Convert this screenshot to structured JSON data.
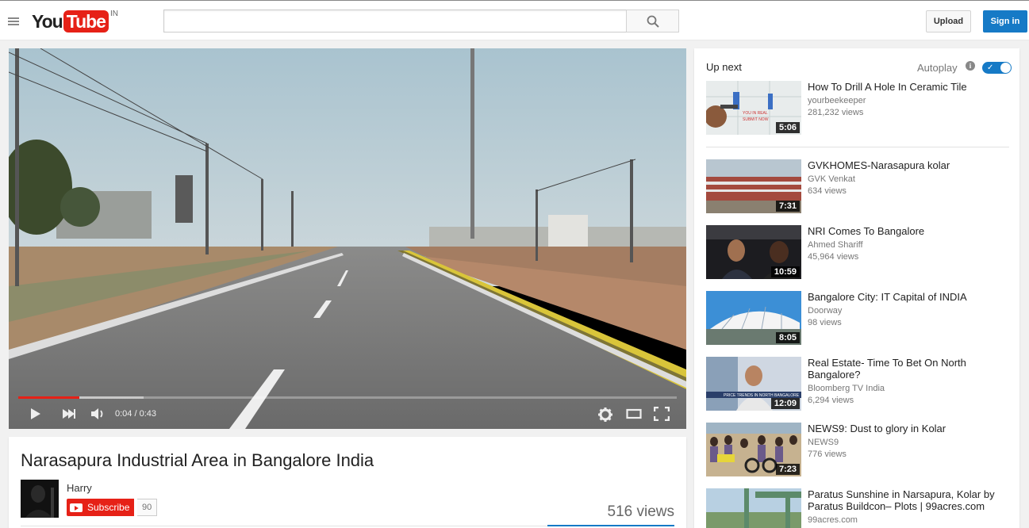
{
  "masthead": {
    "logo_you": "You",
    "logo_tube": "Tube",
    "logo_country": "IN",
    "search_placeholder": "",
    "upload_label": "Upload",
    "signin_label": "Sign in"
  },
  "player": {
    "current_time": "0:04",
    "separator": " / ",
    "duration": "0:43",
    "played_fraction": 0.093,
    "buffered_fraction": 0.19
  },
  "video": {
    "title": "Narasapura Industrial Area in Bangalore India",
    "channel": "Harry",
    "subscribe_label": "Subscribe",
    "subscriber_count": "90",
    "views": "516 views"
  },
  "sidebar": {
    "up_next_label": "Up next",
    "autoplay_label": "Autoplay",
    "autoplay_on": true,
    "items": [
      {
        "title": "How To Drill A Hole In Ceramic Tile",
        "channel": "yourbeekeeper",
        "views": "281,232 views",
        "duration": "5:06",
        "thumb": "tile"
      },
      {
        "title": "GVKHOMES-Narasapura kolar",
        "channel": "GVK Venkat",
        "views": "634 views",
        "duration": "7:31",
        "thumb": "building"
      },
      {
        "title": "NRI Comes To Bangalore",
        "channel": "Ahmed Shariff",
        "views": "45,964 views",
        "duration": "10:59",
        "thumb": "car"
      },
      {
        "title": "Bangalore City: IT Capital of INDIA",
        "channel": "Doorway",
        "views": "98 views",
        "duration": "8:05",
        "thumb": "airport"
      },
      {
        "title": "Real Estate- Time To Bet On North Bangalore?",
        "channel": "Bloomberg TV India",
        "views": "6,294 views",
        "duration": "12:09",
        "thumb": "news"
      },
      {
        "title": "NEWS9: Dust to glory in Kolar",
        "channel": "NEWS9",
        "views": "776 views",
        "duration": "7:23",
        "thumb": "crowd"
      },
      {
        "title": "Paratus Sunshine in Narsapura, Kolar by Paratus Buildcon– Plots | 99acres.com",
        "channel": "99acres.com",
        "views": "",
        "duration": "",
        "thumb": "gate"
      }
    ]
  }
}
